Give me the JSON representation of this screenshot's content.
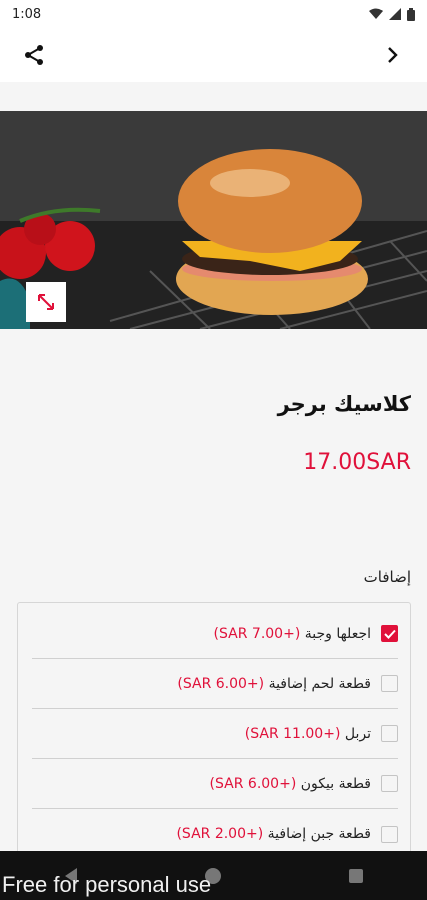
{
  "status": {
    "time": "1:08",
    "icons": [
      "wifi-icon",
      "signal-icon",
      "battery-icon"
    ]
  },
  "app_bar": {
    "left_icon": "share-icon",
    "right_icon": "chevron-right-icon"
  },
  "hero": {
    "image": "classic-burger-photo",
    "expand_icon": "expand-icon"
  },
  "product": {
    "title": "كلاسيك برجر",
    "price": "17.00SAR"
  },
  "addons": {
    "title": "إضافات",
    "items": [
      {
        "label": "اجعلها وجبة ",
        "price": "(+7.00 SAR)",
        "checked": true
      },
      {
        "label": "قطعة لحم إضافية ",
        "price": "(+6.00 SAR)",
        "checked": false
      },
      {
        "label": "تربل ",
        "price": "(+11.00 SAR)",
        "checked": false
      },
      {
        "label": "قطعة بيكون ",
        "price": "(+6.00 SAR)",
        "checked": false
      },
      {
        "label": "قطعة جبن إضافية ",
        "price": "(+2.00 SAR)",
        "checked": false
      }
    ]
  },
  "watermark": "Free for personal use",
  "colors": {
    "accent": "#e0113a",
    "background": "#f5f5f5"
  }
}
